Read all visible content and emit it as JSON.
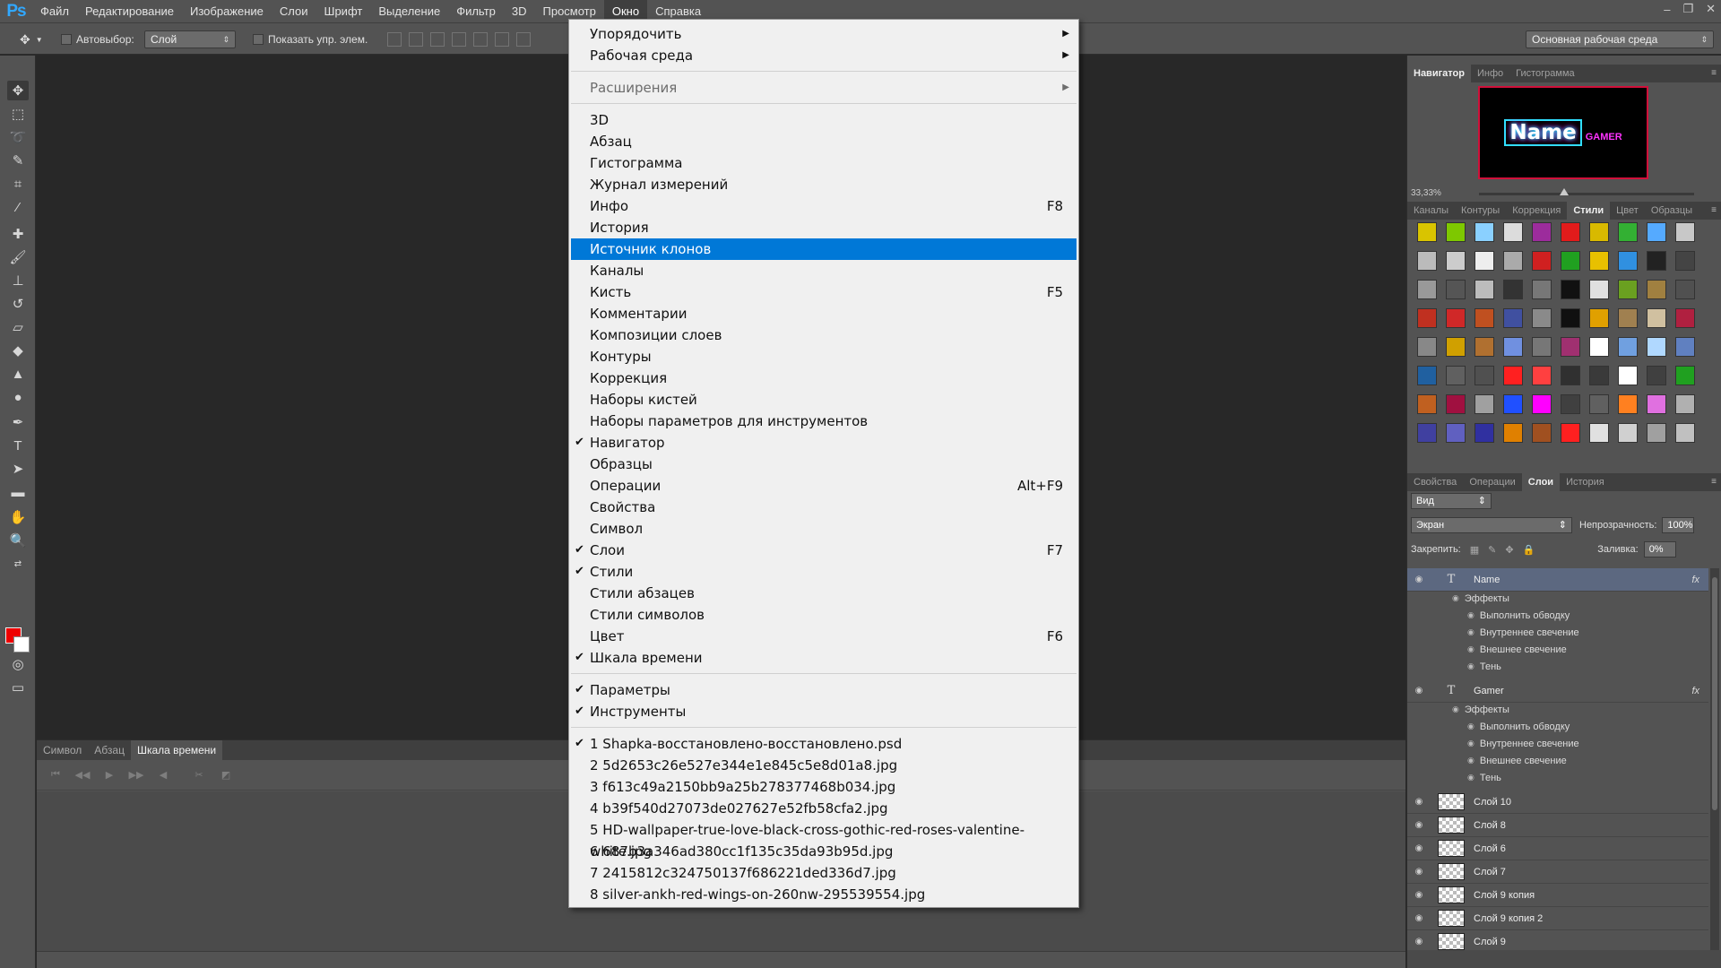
{
  "menubar": {
    "logo": "Ps",
    "items": [
      "Файл",
      "Редактирование",
      "Изображение",
      "Слои",
      "Шрифт",
      "Выделение",
      "Фильтр",
      "3D",
      "Просмотр",
      "Окно",
      "Справка"
    ],
    "active_index": 9
  },
  "options": {
    "autoselect_label": "Автовыбор:",
    "autoselect_value": "Слой",
    "show_controls_label": "Показать упр. элем.",
    "workspace": "Основная рабочая среда"
  },
  "timeline": {
    "tabs": [
      "Символ",
      "Абзац",
      "Шкала времени"
    ],
    "active_tab": 2
  },
  "panels": {
    "nav_tabs": [
      "Навигатор",
      "Инфо",
      "Гистограмма"
    ],
    "nav_thumb_text": "Name",
    "nav_thumb_subtext": "GAMER",
    "zoom": "33,33%",
    "style_tabs": [
      "Каналы",
      "Контуры",
      "Коррекция",
      "Стили",
      "Цвет",
      "Образцы"
    ],
    "layer_tabs": [
      "Свойства",
      "Операции",
      "Слои",
      "История"
    ],
    "kind_filter": "Вид",
    "blend_mode": "Экран",
    "opacity_label": "Непрозрачность:",
    "opacity_value": "100%",
    "lock_label": "Закрепить:",
    "fill_label": "Заливка:",
    "fill_value": "0%"
  },
  "swatch_colors": [
    "#d9c400",
    "#7ec800",
    "#8ad0ff",
    "#dcdcdc",
    "#9c2c9c",
    "#e21b1b",
    "#d8b900",
    "#33b033",
    "#55aaff",
    "#c8c8c8",
    "#bbbbbb",
    "#cccccc",
    "#eeeeee",
    "#aaaaaa",
    "#d02020",
    "#20a020",
    "#e8c000",
    "#3090e0",
    "#222222",
    "#444444",
    "#999999",
    "#555555",
    "#bcbcbc",
    "#333333",
    "#777777",
    "#111111",
    "#e0e0e0",
    "#6aa020",
    "#a08040",
    "#505050",
    "#c03020",
    "#d02828",
    "#c05020",
    "#4050a0",
    "#8a8a8a",
    "#101010",
    "#e0a000",
    "#a08050",
    "#d0c0a0",
    "#b02040",
    "#888888",
    "#d0a000",
    "#b07030",
    "#7090e0",
    "#777777",
    "#a03070",
    "#ffffff",
    "#70a0e0",
    "#b0d8ff",
    "#6080c0",
    "#2060a0",
    "#606060",
    "#505050",
    "#ff2020",
    "#ff4040",
    "#303030",
    "#3a3a3a",
    "#ffffff",
    "#404040",
    "#20a020",
    "#c06020",
    "#a01040",
    "#a0a0a0",
    "#2050ff",
    "#ff00ff",
    "#404040",
    "#606060",
    "#ff8020",
    "#e070e0",
    "#b0b0b0",
    "#4040a0",
    "#6060c0",
    "#3030a0",
    "#e08000",
    "#a05020",
    "#ff2020",
    "#e0e0e0",
    "#d0d0d0",
    "#a0a0a0",
    "#c0c0c0"
  ],
  "layers": {
    "items": [
      {
        "name": "Name",
        "type": "text",
        "fx": "fx",
        "selected": true,
        "effects_label": "Эффекты",
        "effects": [
          "Выполнить обводку",
          "Внутреннее свечение",
          "Внешнее свечение",
          "Тень"
        ]
      },
      {
        "name": "Gamer",
        "type": "text",
        "fx": "fx",
        "selected": false,
        "effects_label": "Эффекты",
        "effects": [
          "Выполнить обводку",
          "Внутреннее свечение",
          "Внешнее свечение",
          "Тень"
        ]
      },
      {
        "name": "Слой 10",
        "type": "pixel"
      },
      {
        "name": "Слой 8",
        "type": "pixel"
      },
      {
        "name": "Слой 6",
        "type": "pixel"
      },
      {
        "name": "Слой 7",
        "type": "pixel"
      },
      {
        "name": "Слой 9 копия",
        "type": "pixel"
      },
      {
        "name": "Слой 9 копия 2",
        "type": "pixel"
      },
      {
        "name": "Слой 9",
        "type": "pixel"
      }
    ]
  },
  "dropdown": {
    "items": [
      {
        "label": "Упорядочить",
        "submenu": true
      },
      {
        "label": "Рабочая среда",
        "submenu": true
      },
      {
        "sep": true
      },
      {
        "label": "Расширения",
        "submenu": true,
        "disabled": true
      },
      {
        "sep": true
      },
      {
        "label": "3D"
      },
      {
        "label": "Абзац"
      },
      {
        "label": "Гистограмма"
      },
      {
        "label": "Журнал измерений"
      },
      {
        "label": "Инфо",
        "shortcut": "F8"
      },
      {
        "label": "История"
      },
      {
        "label": "Источник клонов",
        "highlight": true
      },
      {
        "label": "Каналы"
      },
      {
        "label": "Кисть",
        "shortcut": "F5"
      },
      {
        "label": "Комментарии"
      },
      {
        "label": "Композиции слоев"
      },
      {
        "label": "Контуры"
      },
      {
        "label": "Коррекция"
      },
      {
        "label": "Наборы кистей"
      },
      {
        "label": "Наборы параметров для инструментов"
      },
      {
        "label": "Навигатор",
        "checked": true
      },
      {
        "label": "Образцы"
      },
      {
        "label": "Операции",
        "shortcut": "Alt+F9"
      },
      {
        "label": "Свойства"
      },
      {
        "label": "Символ"
      },
      {
        "label": "Слои",
        "checked": true,
        "shortcut": "F7"
      },
      {
        "label": "Стили",
        "checked": true
      },
      {
        "label": "Стили абзацев"
      },
      {
        "label": "Стили символов"
      },
      {
        "label": "Цвет",
        "shortcut": "F6"
      },
      {
        "label": "Шкала времени",
        "checked": true
      },
      {
        "sep": true
      },
      {
        "label": "Параметры",
        "checked": true
      },
      {
        "label": "Инструменты",
        "checked": true
      },
      {
        "sep": true
      },
      {
        "label": "1 Shapka-восстановлено-восстановлено.psd",
        "checked": true
      },
      {
        "label": "2 5d2653c26e527e344e1e845c5e8d01a8.jpg"
      },
      {
        "label": "3 f613c49a2150bb9a25b278377468b034.jpg"
      },
      {
        "label": "4 b39f540d27073de027627e52fb58cfa2.jpg"
      },
      {
        "label": "5 HD-wallpaper-true-love-black-cross-gothic-red-roses-valentine-white.jpg"
      },
      {
        "label": "6 687b3a346ad380cc1f135c35da93b95d.jpg"
      },
      {
        "label": "7 2415812c324750137f686221ded336d7.jpg"
      },
      {
        "label": "8 silver-ankh-red-wings-on-260nw-295539554.jpg"
      }
    ]
  }
}
